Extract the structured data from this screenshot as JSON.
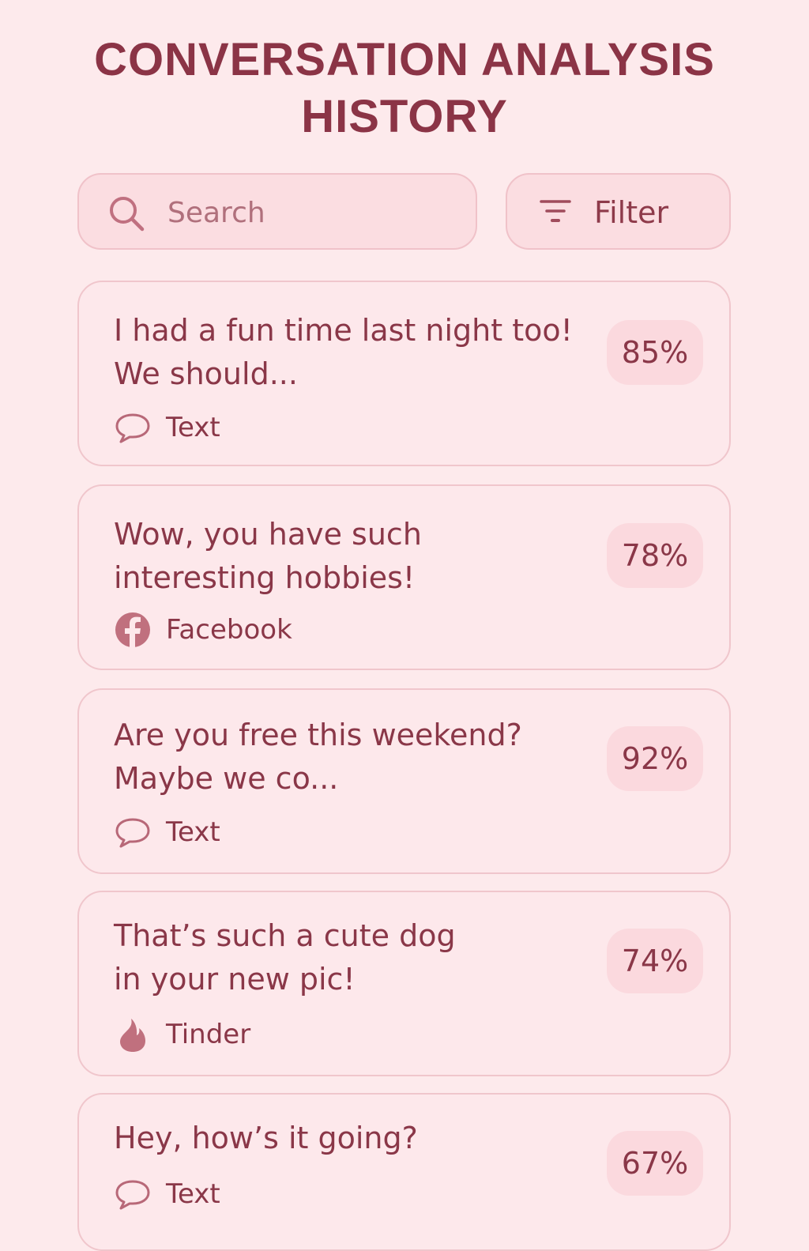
{
  "header": {
    "title_line1": "CONVERSATION ANALYSIS",
    "title_line2": "HISTORY"
  },
  "search": {
    "placeholder": "Search",
    "value": "",
    "icon": "search-icon"
  },
  "filter": {
    "label": "Filter",
    "icon": "filter-icon"
  },
  "colors": {
    "background": "#fdeaec",
    "accent": "#8b3446",
    "badge": "#fbd9de",
    "border": "#f0c6cc"
  },
  "conversations": [
    {
      "line1": "I had a fun time last night too!",
      "line2": "We should...",
      "score": "85%",
      "score_value": 0.85,
      "source": "Text",
      "source_icon": "speech-bubble-icon"
    },
    {
      "line1": "Wow, you have such",
      "line2": "interesting hobbies!",
      "score": "78%",
      "score_value": 0.78,
      "source": "Facebook",
      "source_icon": "facebook-icon"
    },
    {
      "line1": "Are you free this weekend?",
      "line2": "Maybe we co...",
      "score": "92%",
      "score_value": 0.92,
      "source": "Text",
      "source_icon": "speech-bubble-icon"
    },
    {
      "line1": "That’s such a cute dog",
      "line2": "in your new pic!",
      "score": "74%",
      "score_value": 0.74,
      "source": "Tinder",
      "source_icon": "tinder-flame-icon"
    },
    {
      "line1": "Hey, how’s it going?",
      "line2": "",
      "score": "67%",
      "score_value": 0.67,
      "source": "Text",
      "source_icon": "speech-bubble-icon"
    }
  ]
}
